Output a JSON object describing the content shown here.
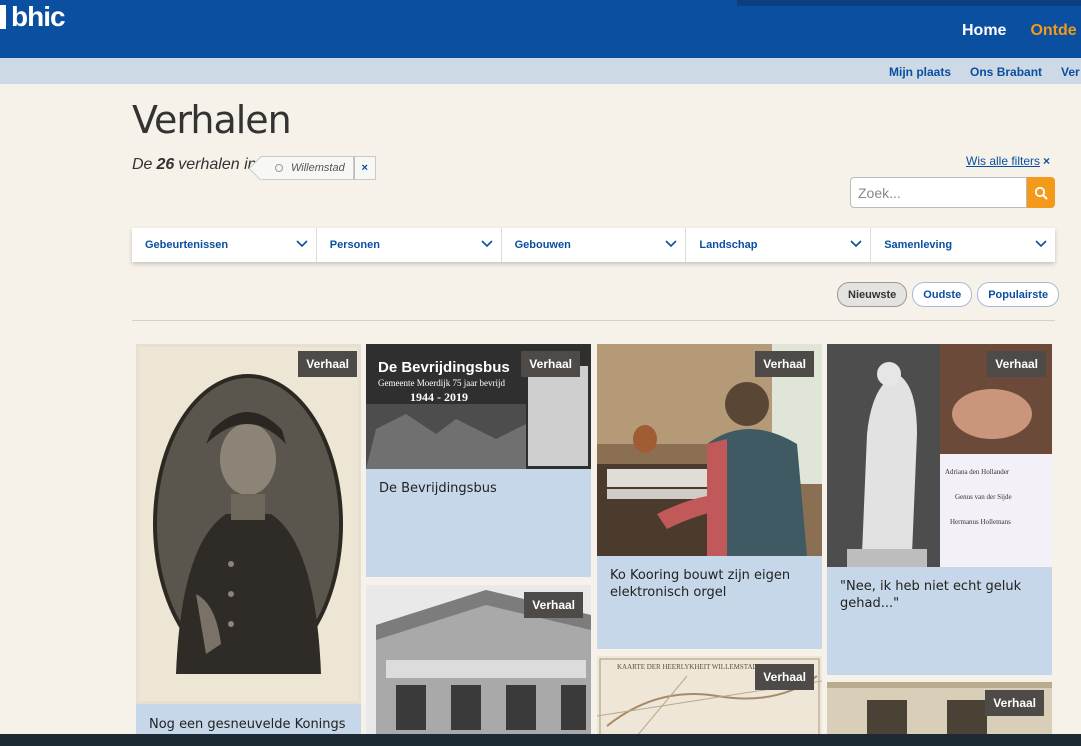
{
  "header": {
    "logo": "bhic",
    "nav": [
      {
        "label": "Home"
      },
      {
        "label": "Ontde"
      }
    ],
    "subnav": [
      {
        "label": "Mijn plaats"
      },
      {
        "label": "Ons Brabant"
      },
      {
        "label": "Ver"
      }
    ]
  },
  "page": {
    "title": "Verhalen",
    "summary_prefix": "De",
    "count": "26",
    "summary_suffix": "verhalen in",
    "active_filter": "Willemstad",
    "active_filter_remove": "×",
    "clear_filters": "Wis alle filters",
    "clear_filters_icon": "×"
  },
  "search": {
    "placeholder": "Zoek...",
    "icon": "search-icon"
  },
  "filters": [
    {
      "label": "Gebeurtenissen"
    },
    {
      "label": "Personen"
    },
    {
      "label": "Gebouwen"
    },
    {
      "label": "Landschap"
    },
    {
      "label": "Samenleving"
    }
  ],
  "sort": [
    {
      "label": "Nieuwste",
      "selected": true
    },
    {
      "label": "Oudste",
      "selected": false
    },
    {
      "label": "Populairste",
      "selected": false
    }
  ],
  "cards": [
    {
      "badge": "Verhaal",
      "title": "Nog een gesneuvelde Konings"
    },
    {
      "badge": "Verhaal",
      "title": "De Bevrijdingsbus",
      "image_text": {
        "heading": "De Bevrijdingsbus",
        "sub": "Gemeente Moerdijk 75 jaar bevrijd",
        "years": "1944 - 2019"
      }
    },
    {
      "badge": "Verhaal",
      "title": "Ko Kooring bouwt zijn eigen elektronisch orgel"
    },
    {
      "badge": "Verhaal",
      "title": "\"Nee, ik heb niet echt geluk gehad...\"",
      "image_text": {
        "l1": "Adriana den Hollander",
        "l2": "Genus van der Sijde",
        "l3": "Hermanus Hollemans"
      }
    },
    {
      "badge": "Verhaal",
      "title": ""
    },
    {
      "badge": "Verhaal",
      "title": "",
      "image_text": {
        "heading": "KAARTE DER HEERLYKHEIT WILLEMSTAD"
      }
    },
    {
      "badge": "Verhaal",
      "title": ""
    }
  ],
  "colors": {
    "brand": "#0a4fa0",
    "accent": "#f39a1a",
    "card": "#c5d7e8"
  }
}
